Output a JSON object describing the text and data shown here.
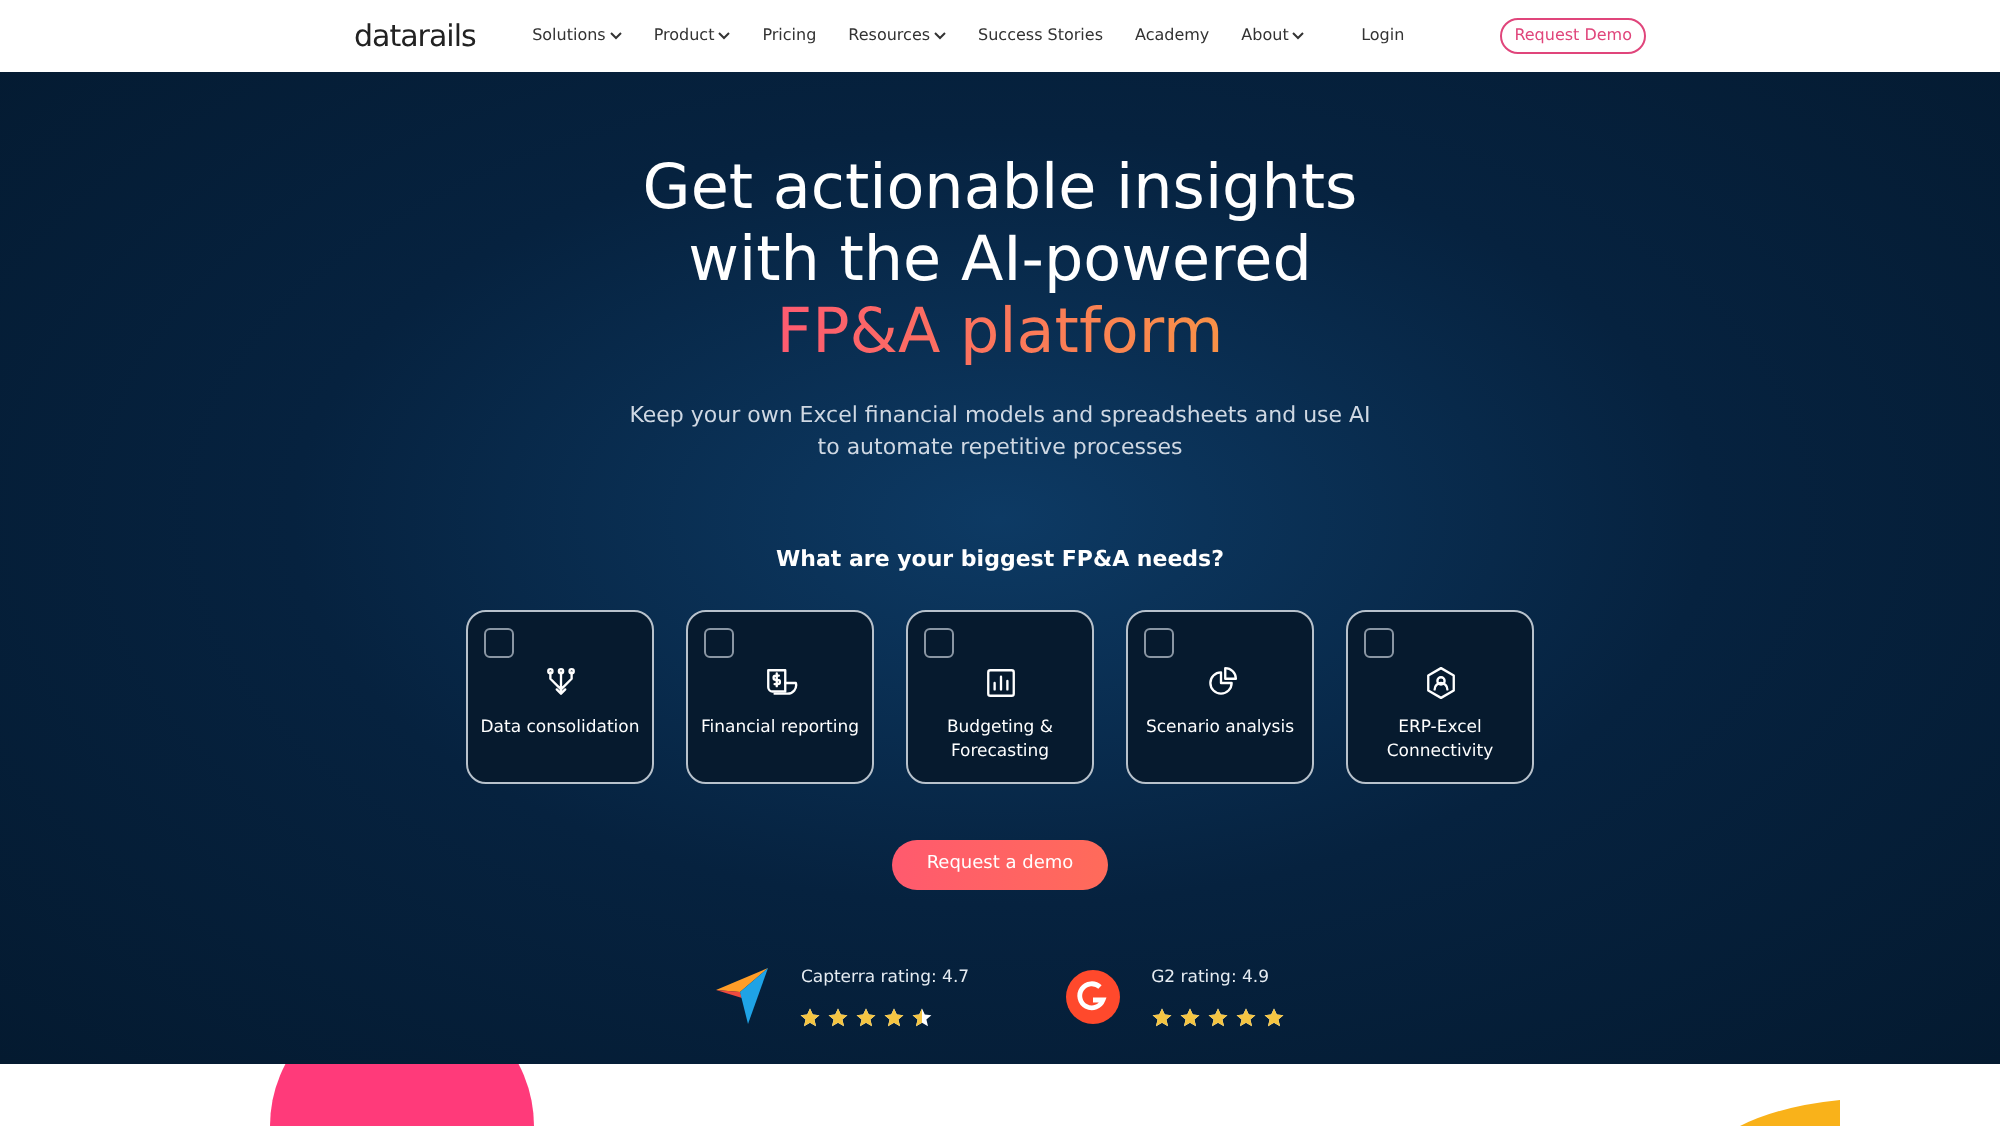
{
  "header": {
    "logo": "datarails",
    "nav": [
      {
        "label": "Solutions",
        "dropdown": true
      },
      {
        "label": "Product",
        "dropdown": true
      },
      {
        "label": "Pricing",
        "dropdown": false
      },
      {
        "label": "Resources",
        "dropdown": true
      },
      {
        "label": "Success Stories",
        "dropdown": false
      },
      {
        "label": "Academy",
        "dropdown": false
      },
      {
        "label": "About",
        "dropdown": true
      }
    ],
    "login": "Login",
    "cta": "Request Demo"
  },
  "hero": {
    "title_lines": [
      "Get actionable insights",
      "with the AI-powered"
    ],
    "title_highlight": "FP&A platform",
    "subtitle": "Keep your own Excel financial models and spreadsheets and use AI to automate repetitive processes",
    "question": "What are your biggest FP&A needs?",
    "needs": [
      {
        "label": "Data consolidation",
        "checked": false
      },
      {
        "label": "Financial reporting",
        "checked": false
      },
      {
        "label": "Budgeting & Forecasting",
        "checked": false
      },
      {
        "label": "Scenario analysis",
        "checked": false
      },
      {
        "label": "ERP-Excel Connectivity",
        "checked": false
      }
    ],
    "cta": "Request a demo",
    "ratings": [
      {
        "kind": "capterra",
        "label": "Capterra rating: 4.7",
        "stars": 4.5
      },
      {
        "kind": "g2",
        "label": "G2 rating: 4.9",
        "stars": 5
      }
    ]
  }
}
